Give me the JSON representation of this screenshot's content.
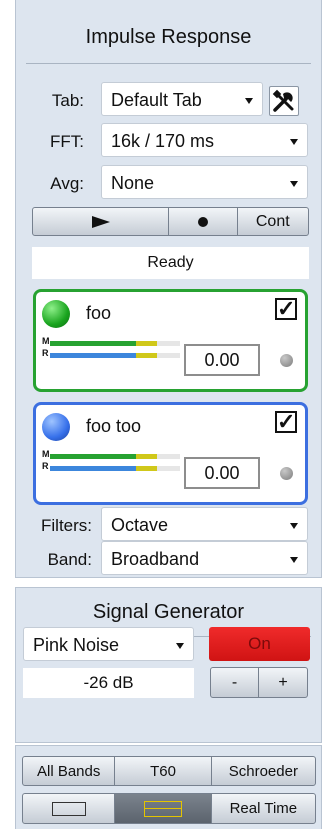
{
  "impulse": {
    "title": "Impulse Response",
    "tab_label": "Tab:",
    "tab_value": "Default Tab",
    "fft_label": "FFT:",
    "fft_value": "16k / 170 ms",
    "avg_label": "Avg:",
    "avg_value": "None",
    "transport": {
      "play_icon": "play-icon",
      "record_icon": "record-icon",
      "cont_label": "Cont"
    },
    "status": "Ready",
    "channels": [
      {
        "name": "foo",
        "value": "0.00",
        "color": "#27a231",
        "checked": true,
        "m_label": "M",
        "r_label": "R",
        "m_level": 0.66,
        "r_level": 0.66,
        "m_peak": 0.82,
        "r_peak": 0.82
      },
      {
        "name": "foo too",
        "value": "0.00",
        "color": "#3c6fe0",
        "checked": true,
        "m_label": "M",
        "r_label": "R",
        "m_level": 0.66,
        "r_level": 0.66,
        "m_peak": 0.82,
        "r_peak": 0.82
      }
    ],
    "filters_label": "Filters:",
    "filters_value": "Octave",
    "band_label": "Band:",
    "band_value": "Broadband"
  },
  "generator": {
    "title": "Signal Generator",
    "type_value": "Pink Noise",
    "on_label": "On",
    "level": "-26 dB",
    "minus_label": "-",
    "plus_label": "+"
  },
  "modes": {
    "all_bands": "All Bands",
    "t60": "T60",
    "schroeder": "Schroeder",
    "real_time": "Real Time",
    "icons": [
      "rectangle-icon",
      "band-icon"
    ]
  },
  "colors": {
    "on_button": "#e51c1c",
    "panel_bg": "#dde5ef",
    "meter_yellow": "#d0c81a"
  }
}
